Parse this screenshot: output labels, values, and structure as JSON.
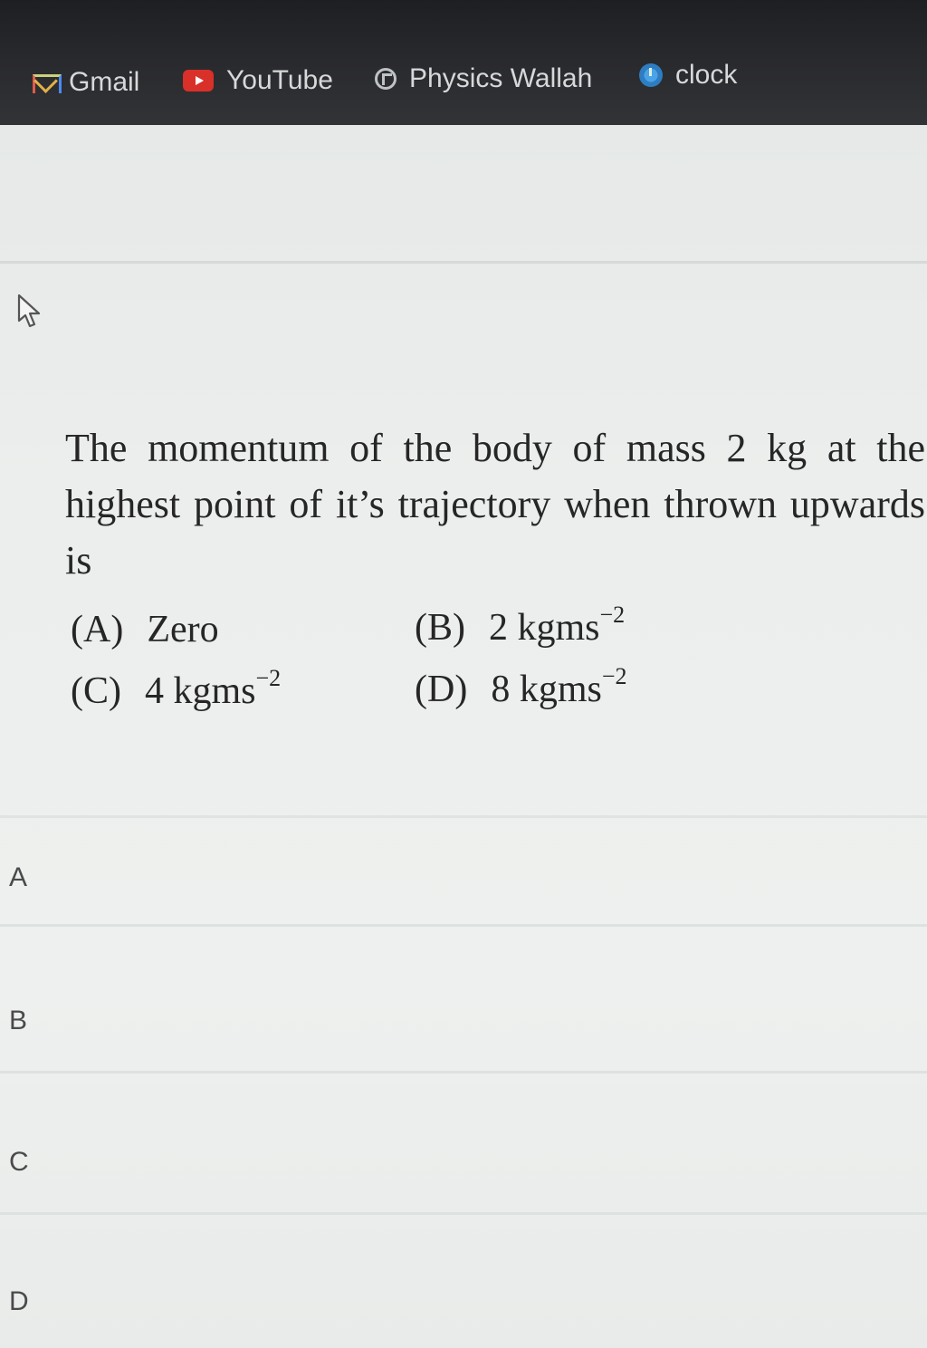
{
  "bookmarks": [
    {
      "label": "Gmail",
      "icon": "gmail-icon"
    },
    {
      "label": "YouTube",
      "icon": "youtube-icon"
    },
    {
      "label": "Physics Wallah",
      "icon": "physics-wallah-icon"
    },
    {
      "label": "clock",
      "icon": "clock-icon"
    }
  ],
  "question": {
    "text": "The momentum of the body of mass 2 kg at the highest point of it’s trajectory when thrown upwards is",
    "options": [
      {
        "letter": "(A)",
        "value": "Zero",
        "unit_exp": ""
      },
      {
        "letter": "(B)",
        "value": "2 kgms",
        "unit_exp": "−2"
      },
      {
        "letter": "(C)",
        "value": "4 kgms",
        "unit_exp": "−2"
      },
      {
        "letter": "(D)",
        "value": "8 kgms",
        "unit_exp": "−2"
      }
    ]
  },
  "answers": [
    "A",
    "B",
    "C",
    "D"
  ],
  "colors": {
    "bar": "#2a2b2e",
    "text": "#262626",
    "youtube": "#d9302a"
  }
}
